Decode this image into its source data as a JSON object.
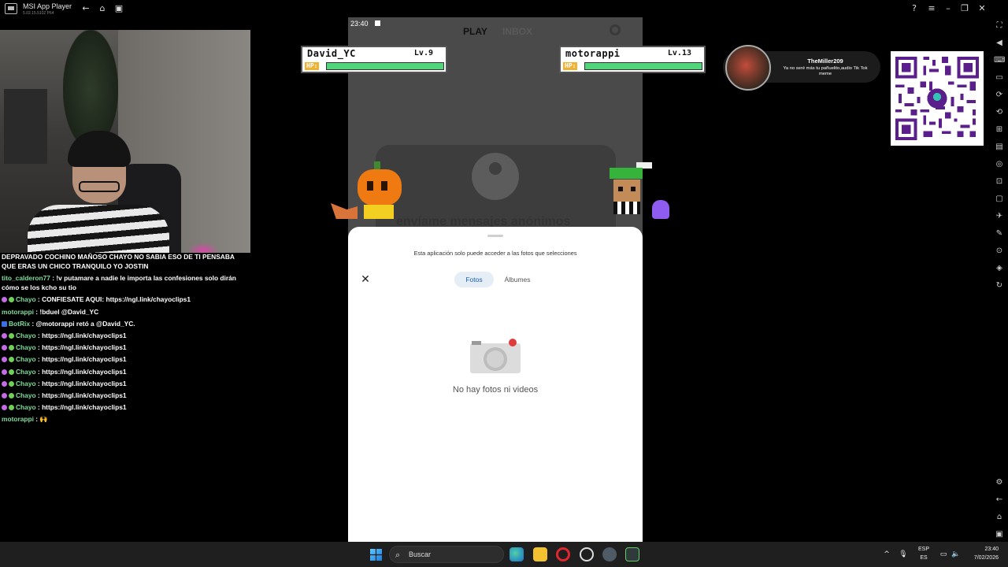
{
  "window": {
    "app_name": "MSI App Player",
    "app_version": "5.02.15.5102  P64"
  },
  "titlebar_icons": [
    "back-icon",
    "home-icon",
    "multi-instance-icon",
    "help-icon",
    "menu-icon",
    "minimize-icon",
    "restore-icon",
    "close-icon"
  ],
  "hp_cards": [
    {
      "name": "David_YC",
      "level": "Lv.9",
      "hp_label": "HP:",
      "hp_fraction": 1.0
    },
    {
      "name": "motorappi",
      "level": "Lv.13",
      "hp_label": "HP:",
      "hp_fraction": 1.0
    }
  ],
  "chat": [
    {
      "user": "",
      "text": "DEPRAVADO COCHINO MAÑOSO CHAYO NO SABIA ESO DE TI PENSABA QUE ERAS UN CHICO TRANQUILO YO JOSTIN"
    },
    {
      "user": "tito_calderon77",
      "sep": " : ",
      "text": "!v putamare a nadie le importa las confesiones solo dirán cómo se los kcho su tio"
    },
    {
      "user": "Chayo",
      "sep": " : ",
      "text": "CONFIESATE AQUI: https://ngl.link/chayoclips1"
    },
    {
      "user": "motorappi",
      "sep": " : ",
      "text": "!bduel @David_YC"
    },
    {
      "user": "BotRix",
      "sep": " : ",
      "text": "@motorappi retó a @David_YC."
    },
    {
      "user": "Chayo",
      "sep": " : ",
      "text": "https://ngl.link/chayoclips1"
    },
    {
      "user": "Chayo",
      "sep": " : ",
      "text": "https://ngl.link/chayoclips1"
    },
    {
      "user": "Chayo",
      "sep": " : ",
      "text": "https://ngl.link/chayoclips1"
    },
    {
      "user": "Chayo",
      "sep": " : ",
      "text": "https://ngl.link/chayoclips1"
    },
    {
      "user": "Chayo",
      "sep": " : ",
      "text": "https://ngl.link/chayoclips1"
    },
    {
      "user": "Chayo",
      "sep": " : ",
      "text": "https://ngl.link/chayoclips1"
    },
    {
      "user": "Chayo",
      "sep": " : ",
      "text": "https://ngl.link/chayoclips1"
    },
    {
      "user": "motorappi",
      "sep": " : ",
      "text": "🙌"
    }
  ],
  "phone": {
    "status_time": "23:40",
    "tab_play": "PLAY",
    "tab_other": "INBOX",
    "card_title": "envíame mensajes anónimos",
    "sheet": {
      "note": "Esta aplicación solo puede acceder a las fotos que selecciones",
      "tab_fotos": "Fotos",
      "tab_albumes": "Álbumes",
      "empty_text": "No hay fotos ni videos"
    }
  },
  "tts": {
    "name": "TheMiller209",
    "message": "Ya no seré más tu pañuelito,audio Tik Tok meme"
  },
  "taskbar": {
    "search_placeholder": "Buscar",
    "lang_top": "ESP",
    "lang_bottom": "ES",
    "time": "23:40",
    "date": "7/02/2026"
  },
  "colors": {
    "chat_user": "#7ddc9c",
    "hp_fill": "#52d47a",
    "sheet_tab_active_bg": "#e5edf7",
    "sheet_tab_active_text": "#1a5fb4"
  }
}
